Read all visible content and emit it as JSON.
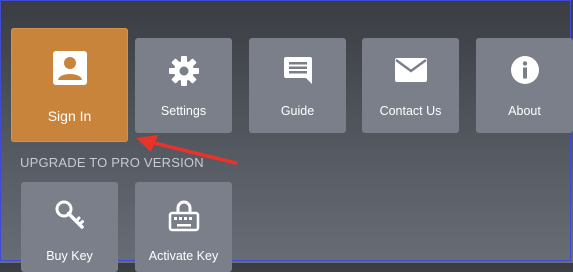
{
  "menu": {
    "tiles": [
      {
        "label": "Sign In",
        "icon": "account-box-icon"
      },
      {
        "label": "Settings",
        "icon": "gear-icon"
      },
      {
        "label": "Guide",
        "icon": "chat-bubble-icon"
      },
      {
        "label": "Contact Us",
        "icon": "envelope-icon"
      },
      {
        "label": "About",
        "icon": "info-icon"
      }
    ]
  },
  "upgrade": {
    "title": "UPGRADE TO PRO VERSION",
    "tiles": [
      {
        "label": "Buy Key",
        "icon": "key-icon"
      },
      {
        "label": "Activate Key",
        "icon": "keyboard-lock-icon"
      }
    ]
  },
  "colors": {
    "selected_tile": "#c8843a",
    "tile": "#7a7f8a",
    "annotation_arrow": "#e8332a"
  }
}
